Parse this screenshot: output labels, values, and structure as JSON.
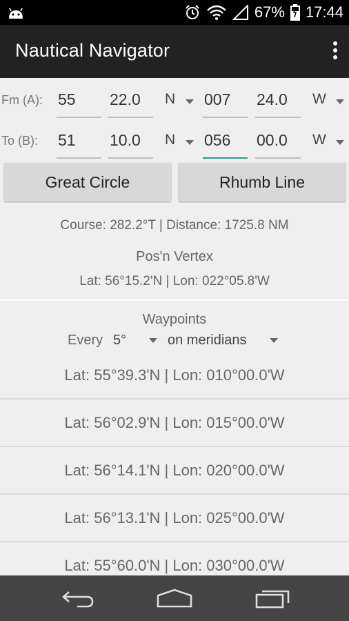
{
  "status_bar": {
    "battery": "67%",
    "time": "17:44",
    "icons": [
      "android-icon",
      "alarm-icon",
      "wifi-icon",
      "signal-icon",
      "battery-icon"
    ]
  },
  "app_bar": {
    "title": "Nautical Navigator",
    "menu_icon": "overflow-menu-icon"
  },
  "from": {
    "label": "Fm (A):",
    "lat_deg": "55",
    "lat_min": "22.0",
    "lat_hemi": "N",
    "lon_deg": "007",
    "lon_min": "24.0",
    "lon_hemi": "W"
  },
  "to": {
    "label": "To (B):",
    "lat_deg": "51",
    "lat_min": "10.0",
    "lat_hemi": "N",
    "lon_deg": "056",
    "lon_min": "00.0",
    "lon_hemi": "W"
  },
  "buttons": {
    "great_circle": "Great Circle",
    "rhumb_line": "Rhumb Line"
  },
  "result": {
    "course_distance": "Course: 282.2°T | Distance: 1725.8 NM",
    "vertex_title": "Pos'n Vertex",
    "vertex_position": "Lat: 56°15.2'N | Lon: 022°05.8'W"
  },
  "waypoints": {
    "title": "Waypoints",
    "every_label": "Every",
    "interval": "5°",
    "mode": "on meridians",
    "items": [
      "Lat: 55°39.3'N | Lon: 010°00.0'W",
      "Lat: 56°02.9'N | Lon: 015°00.0'W",
      "Lat: 56°14.1'N | Lon: 020°00.0'W",
      "Lat: 56°13.1'N | Lon: 025°00.0'W",
      "Lat: 55°60.0'N | Lon: 030°00.0'W"
    ]
  },
  "nav_bar": {
    "icons": [
      "back-icon",
      "home-icon",
      "recents-icon"
    ]
  },
  "colors": {
    "action_bar": "#222222",
    "background": "#efefef",
    "active_underline": "#2a9a8c",
    "button": "#d8d8d8"
  }
}
